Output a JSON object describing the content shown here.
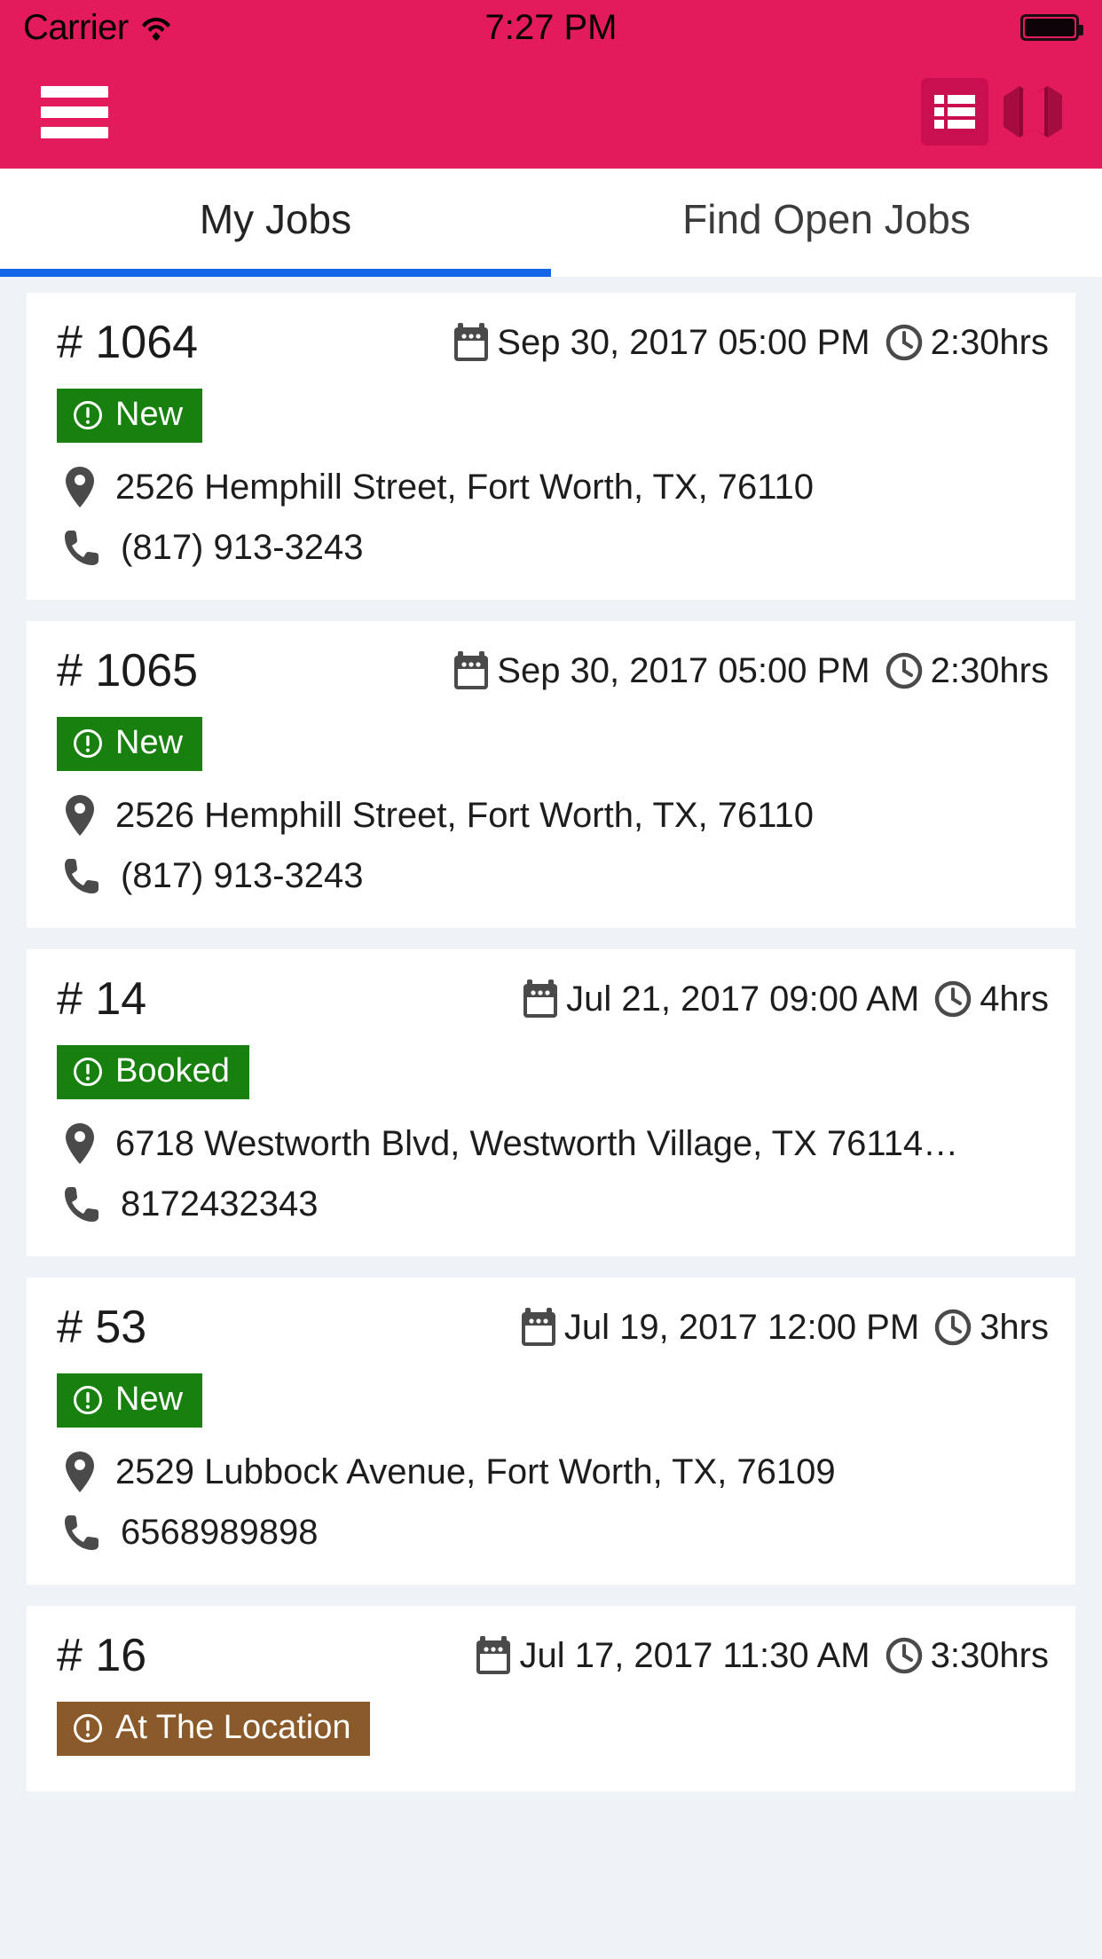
{
  "theme": {
    "header_bg": "#e31a5c",
    "header_icon_active_bg": "#c90f50",
    "header_icon_dark": "#a60c40",
    "tab_indicator": "#1565e8",
    "page_bg": "#eff2f6",
    "card_bg": "#ffffff",
    "badge_green": "#17800e",
    "badge_brown": "#8b5a2b",
    "icon_gray": "#4a4a4a",
    "text_primary": "#1d1d1d"
  },
  "statusbar": {
    "carrier": "Carrier",
    "wifi_icon": "wifi-icon",
    "time": "7:27 PM",
    "battery_icon": "battery-full-icon"
  },
  "navbar": {
    "menu_icon": "hamburger-menu-icon",
    "list_view_icon": "list-view-icon",
    "map_view_icon": "map-view-icon"
  },
  "tabs": [
    {
      "label": "My Jobs",
      "active": true
    },
    {
      "label": "Find Open Jobs",
      "active": false
    }
  ],
  "icons": {
    "calendar": "calendar-icon",
    "clock": "clock-icon",
    "pin": "location-pin-icon",
    "phone": "phone-icon",
    "alert": "alert-circle-icon"
  },
  "jobs": [
    {
      "job_id": "# 1064",
      "date": "Sep 30, 2017 05:00 PM",
      "duration": "2:30hrs",
      "status": "New",
      "status_key": "status-new",
      "address": "2526 Hemphill Street, Fort Worth, TX, 76110",
      "phone": "(817) 913-3243"
    },
    {
      "job_id": "# 1065",
      "date": "Sep 30, 2017 05:00 PM",
      "duration": "2:30hrs",
      "status": "New",
      "status_key": "status-new",
      "address": "2526 Hemphill Street, Fort Worth, TX, 76110",
      "phone": "(817) 913-3243"
    },
    {
      "job_id": "# 14",
      "date": "Jul 21, 2017 09:00 AM",
      "duration": "4hrs",
      "status": "Booked",
      "status_key": "status-booked",
      "address": "6718 Westworth Blvd, Westworth Village, TX 76114,…",
      "phone": "8172432343"
    },
    {
      "job_id": "# 53",
      "date": "Jul 19, 2017 12:00 PM",
      "duration": "3hrs",
      "status": "New",
      "status_key": "status-new",
      "address": "2529 Lubbock Avenue, Fort Worth, TX, 76109",
      "phone": "6568989898"
    },
    {
      "job_id": "# 16",
      "date": "Jul 17, 2017 11:30 AM",
      "duration": "3:30hrs",
      "status": "At The Location",
      "status_key": "status-at-the-location",
      "address": "",
      "phone": ""
    }
  ]
}
